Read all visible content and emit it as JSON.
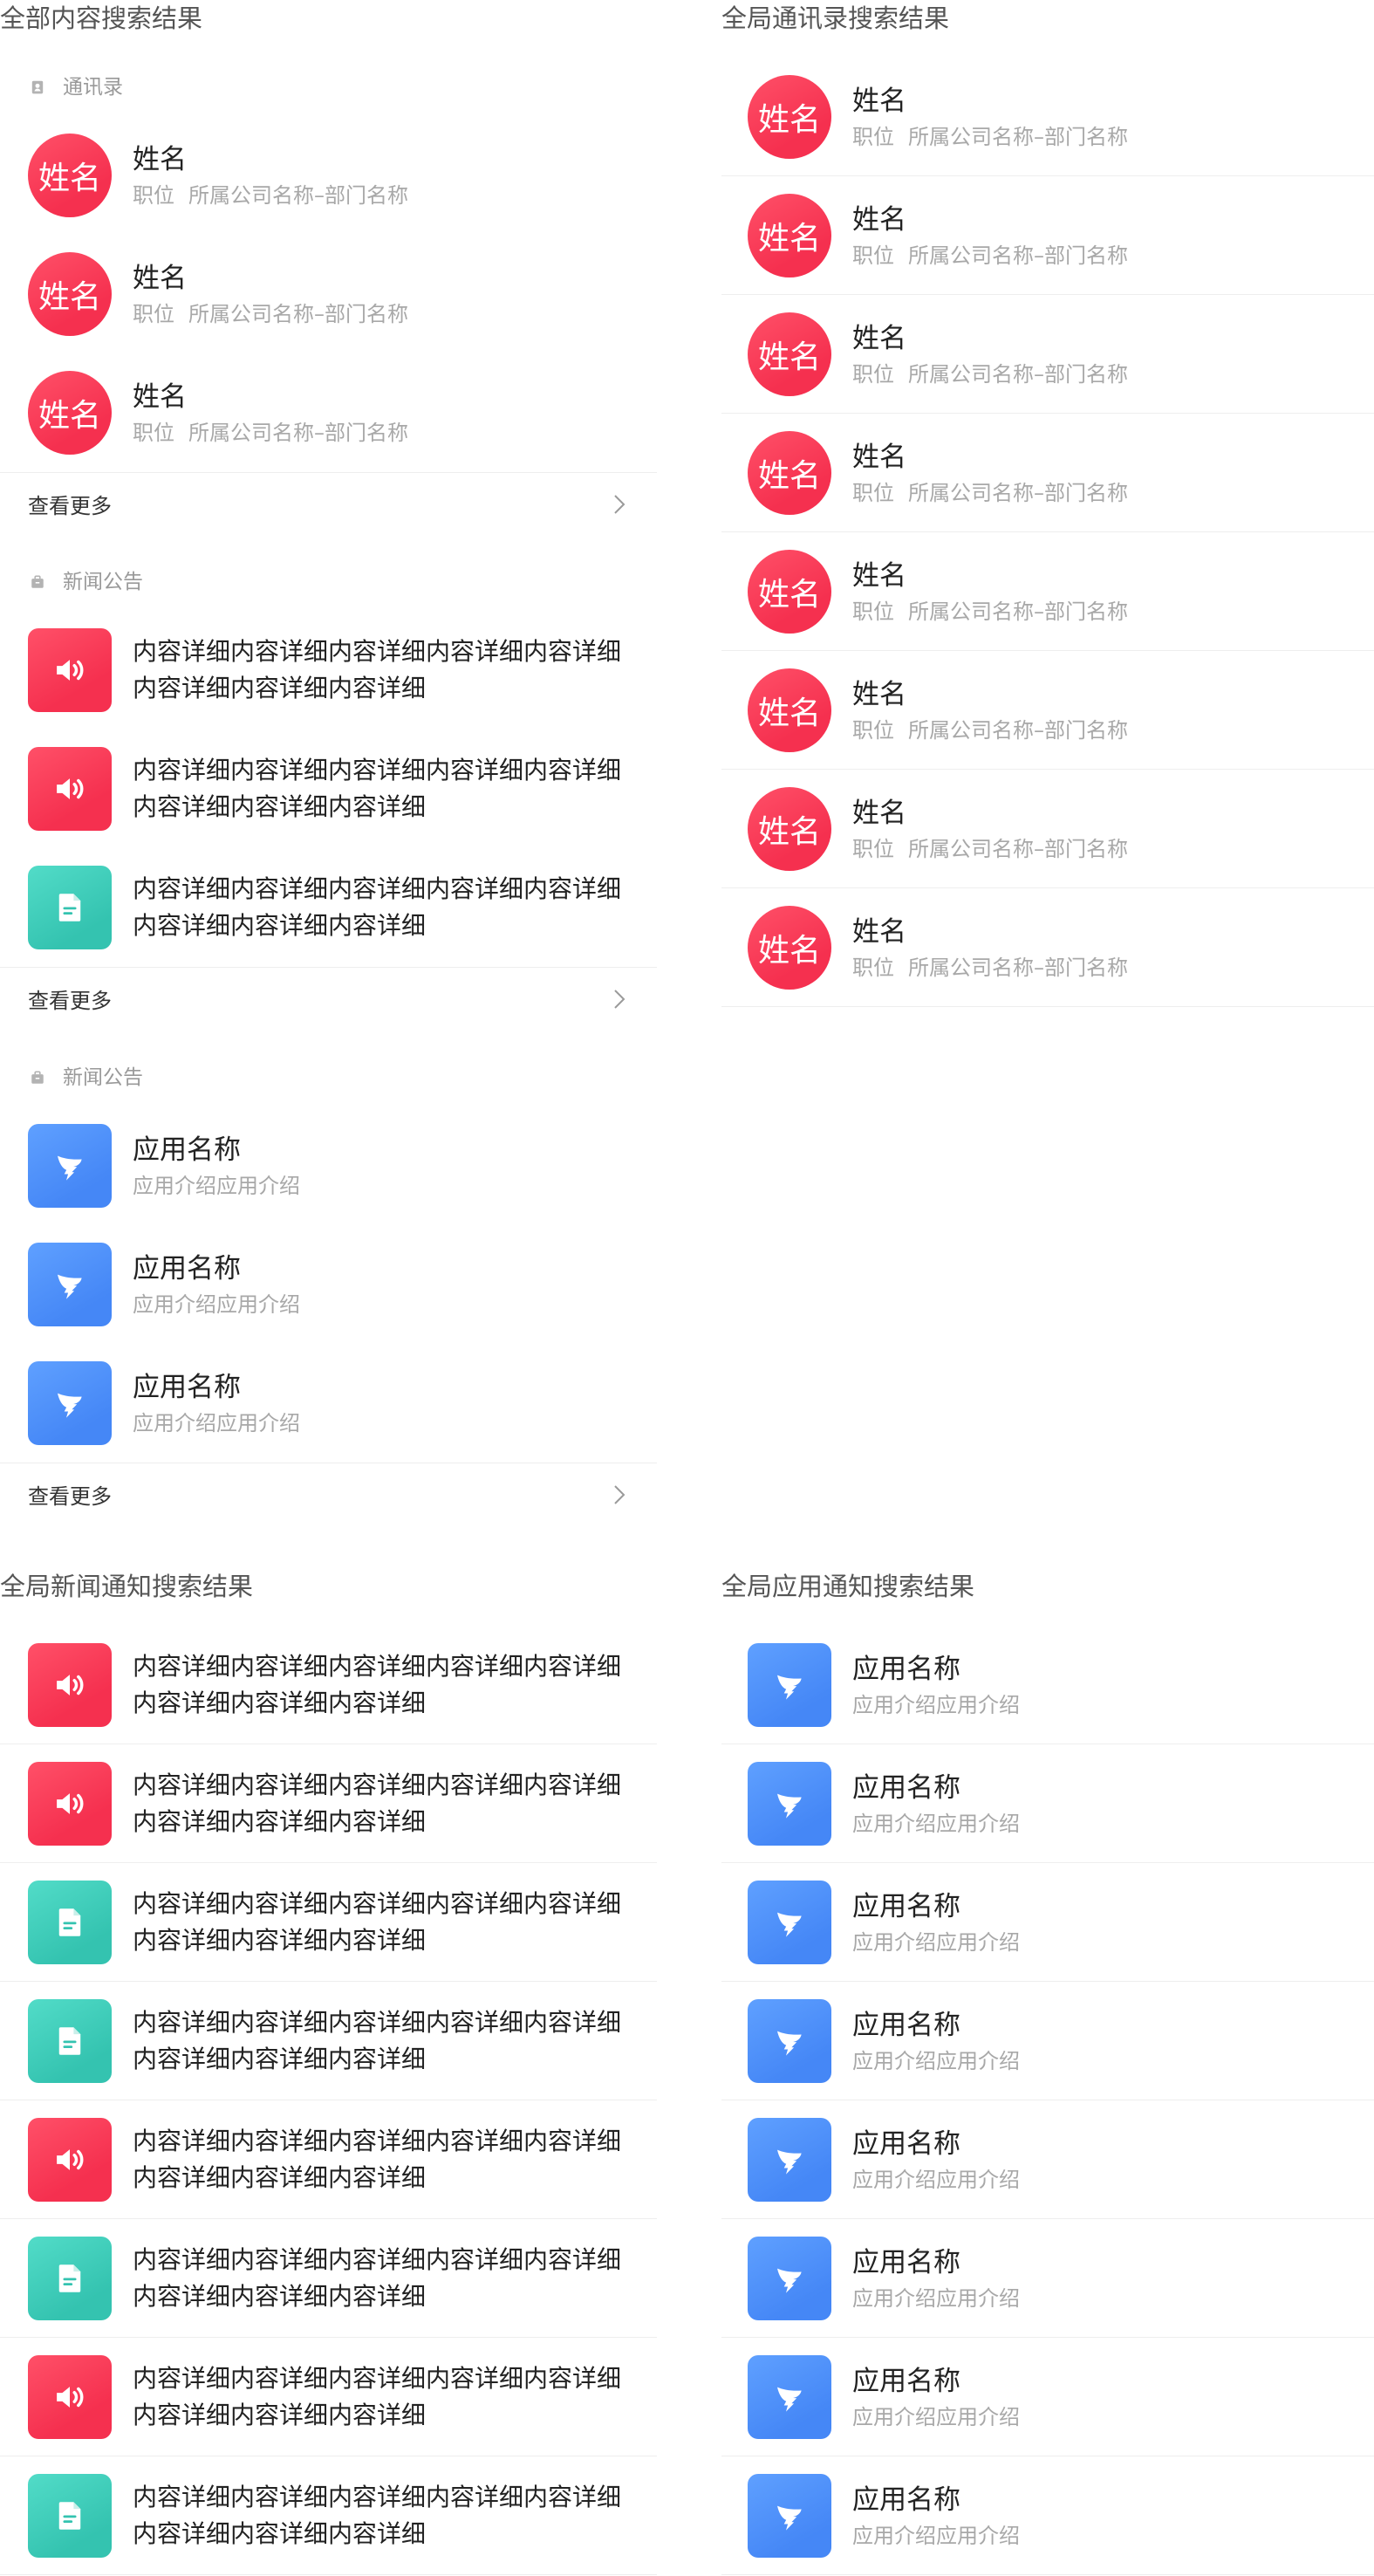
{
  "theme": {
    "avatar_bg": "#f5304f",
    "speaker_bg": "#f5304f",
    "document_bg": "#34c3b0",
    "app_bg": "#4587f6",
    "title_color": "#555555",
    "primary_text": "#222222",
    "secondary_text": "#a8a8a8",
    "divider": "#eeeeee"
  },
  "all_results": {
    "title": "全部内容搜索结果",
    "contacts": {
      "label": "通讯录",
      "icon": "contact-book-icon",
      "items": [
        {
          "avatar_text": "姓名",
          "name": "姓名",
          "position": "职位",
          "org": "所属公司名称–部门名称"
        },
        {
          "avatar_text": "姓名",
          "name": "姓名",
          "position": "职位",
          "org": "所属公司名称–部门名称"
        },
        {
          "avatar_text": "姓名",
          "name": "姓名",
          "position": "职位",
          "org": "所属公司名称–部门名称"
        }
      ],
      "more_label": "查看更多"
    },
    "news": {
      "label": "新闻公告",
      "icon": "briefcase-icon",
      "items": [
        {
          "icon": "speaker-icon",
          "lines": [
            "内容详细内容详细内容详细内容详细内容详细",
            "内容详细内容详细内容详细"
          ]
        },
        {
          "icon": "speaker-icon",
          "lines": [
            "内容详细内容详细内容详细内容详细内容详细",
            "内容详细内容详细内容详细"
          ]
        },
        {
          "icon": "document-icon",
          "lines": [
            "内容详细内容详细内容详细内容详细内容详细",
            "内容详细内容详细内容详细"
          ]
        }
      ],
      "more_label": "查看更多"
    },
    "apps": {
      "label": "新闻公告",
      "icon": "briefcase-icon",
      "items": [
        {
          "icon": "wing-logo-icon",
          "name": "应用名称",
          "desc": "应用介绍应用介绍"
        },
        {
          "icon": "wing-logo-icon",
          "name": "应用名称",
          "desc": "应用介绍应用介绍"
        },
        {
          "icon": "wing-logo-icon",
          "name": "应用名称",
          "desc": "应用介绍应用介绍"
        }
      ],
      "more_label": "查看更多"
    }
  },
  "global_contacts": {
    "title": "全局通讯录搜索结果",
    "items": [
      {
        "avatar_text": "姓名",
        "name": "姓名",
        "position": "职位",
        "org": "所属公司名称–部门名称"
      },
      {
        "avatar_text": "姓名",
        "name": "姓名",
        "position": "职位",
        "org": "所属公司名称–部门名称"
      },
      {
        "avatar_text": "姓名",
        "name": "姓名",
        "position": "职位",
        "org": "所属公司名称–部门名称"
      },
      {
        "avatar_text": "姓名",
        "name": "姓名",
        "position": "职位",
        "org": "所属公司名称–部门名称"
      },
      {
        "avatar_text": "姓名",
        "name": "姓名",
        "position": "职位",
        "org": "所属公司名称–部门名称"
      },
      {
        "avatar_text": "姓名",
        "name": "姓名",
        "position": "职位",
        "org": "所属公司名称–部门名称"
      },
      {
        "avatar_text": "姓名",
        "name": "姓名",
        "position": "职位",
        "org": "所属公司名称–部门名称"
      },
      {
        "avatar_text": "姓名",
        "name": "姓名",
        "position": "职位",
        "org": "所属公司名称–部门名称"
      }
    ]
  },
  "global_news": {
    "title": "全局新闻通知搜索结果",
    "items": [
      {
        "icon": "speaker-icon",
        "lines": [
          "内容详细内容详细内容详细内容详细内容详细",
          "内容详细内容详细内容详细"
        ]
      },
      {
        "icon": "speaker-icon",
        "lines": [
          "内容详细内容详细内容详细内容详细内容详细",
          "内容详细内容详细内容详细"
        ]
      },
      {
        "icon": "document-icon",
        "lines": [
          "内容详细内容详细内容详细内容详细内容详细",
          "内容详细内容详细内容详细"
        ]
      },
      {
        "icon": "document-icon",
        "lines": [
          "内容详细内容详细内容详细内容详细内容详细",
          "内容详细内容详细内容详细"
        ]
      },
      {
        "icon": "speaker-icon",
        "lines": [
          "内容详细内容详细内容详细内容详细内容详细",
          "内容详细内容详细内容详细"
        ]
      },
      {
        "icon": "document-icon",
        "lines": [
          "内容详细内容详细内容详细内容详细内容详细",
          "内容详细内容详细内容详细"
        ]
      },
      {
        "icon": "speaker-icon",
        "lines": [
          "内容详细内容详细内容详细内容详细内容详细",
          "内容详细内容详细内容详细"
        ]
      },
      {
        "icon": "document-icon",
        "lines": [
          "内容详细内容详细内容详细内容详细内容详细",
          "内容详细内容详细内容详细"
        ]
      }
    ]
  },
  "global_apps": {
    "title": "全局应用通知搜索结果",
    "items": [
      {
        "icon": "wing-logo-icon",
        "name": "应用名称",
        "desc": "应用介绍应用介绍"
      },
      {
        "icon": "wing-logo-icon",
        "name": "应用名称",
        "desc": "应用介绍应用介绍"
      },
      {
        "icon": "wing-logo-icon",
        "name": "应用名称",
        "desc": "应用介绍应用介绍"
      },
      {
        "icon": "wing-logo-icon",
        "name": "应用名称",
        "desc": "应用介绍应用介绍"
      },
      {
        "icon": "wing-logo-icon",
        "name": "应用名称",
        "desc": "应用介绍应用介绍"
      },
      {
        "icon": "wing-logo-icon",
        "name": "应用名称",
        "desc": "应用介绍应用介绍"
      },
      {
        "icon": "wing-logo-icon",
        "name": "应用名称",
        "desc": "应用介绍应用介绍"
      },
      {
        "icon": "wing-logo-icon",
        "name": "应用名称",
        "desc": "应用介绍应用介绍"
      }
    ]
  }
}
